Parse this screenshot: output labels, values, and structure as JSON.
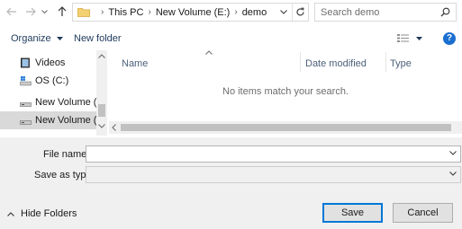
{
  "address_bar": {
    "breadcrumbs": [
      "This PC",
      "New Volume (E:)",
      "demo"
    ],
    "separator": "›"
  },
  "search": {
    "placeholder": "Search demo"
  },
  "toolbar": {
    "organize_label": "Organize",
    "new_folder_label": "New folder",
    "help_label": "?"
  },
  "nav_pane": {
    "items": [
      {
        "label": "Videos",
        "icon": "video-folder-icon",
        "selected": false
      },
      {
        "label": "OS (C:)",
        "icon": "windows-drive-icon",
        "selected": false
      },
      {
        "label": "New Volume (D:",
        "icon": "drive-icon",
        "selected": false
      },
      {
        "label": "New Volume (E:)",
        "icon": "drive-icon",
        "selected": true
      }
    ]
  },
  "file_list": {
    "columns": [
      "Name",
      "Date modified",
      "Type"
    ],
    "empty_message": "No items match your search."
  },
  "form": {
    "file_name_label": "File name:",
    "file_name_value": "",
    "save_as_type_label": "Save as type:",
    "save_as_type_value": ""
  },
  "footer": {
    "hide_folders_label": "Hide Folders",
    "save_label": "Save",
    "cancel_label": "Cancel"
  },
  "colors": {
    "accent": "#0078d7",
    "help": "#1a6fd0",
    "selected_row": "#d9d9d9",
    "form_background": "#f0f0f0"
  }
}
